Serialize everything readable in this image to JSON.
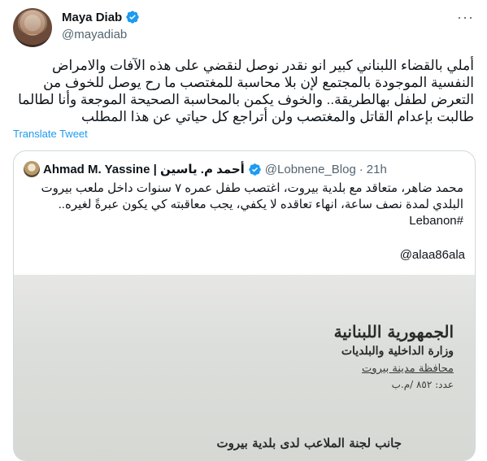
{
  "author": {
    "name": "Maya Diab",
    "handle": "@mayadiab"
  },
  "tweet": {
    "text": "أملي بالقضاء اللبناني كبير انو نقدر نوصل لنقضي على هذه الآفات والامراض النفسية الموجودة بالمجتمع لإن بلا محاسبة للمغتصب ما رح يوصل للخوف من التعرض لطفل بهالطريقة.. والخوف يكمن بالمحاسبة الصحيحة الموجعة وأنا لطالما طالبت بإعدام القاتل والمغتصب ولن أتراجع كل حياتي عن هذا المطلب",
    "translate_label": "Translate Tweet",
    "more_label": "···"
  },
  "quote": {
    "name": "Ahmad M. Yassine | أحمد م. ياسين",
    "handle": "@Lobnene_Blog",
    "separator": "·",
    "time": "21h",
    "text": "محمد ضاهر، متعاقد مع بلدية بيروت، اغتصب طفل عمره ٧ سنوات داخل ملعب بيروت البلدي لمدة نصف ساعة، انهاء تعاقده لا يكفي، يجب معاقبته كي يكون عبرةً لغيره.. #Lebanon",
    "mention": "@alaa86ala",
    "document": {
      "line1": "الجمهورية اللبنانية",
      "line2": "وزارة الداخلية والبلديات",
      "line3": "محافظة مدينة بيروت",
      "line4": "عدد: ٨٥٢ /م.ب",
      "line5": "جانب لجنة الملاعب لدى بلدية بيروت"
    }
  },
  "colors": {
    "verified": "#1d9bf0",
    "link": "#1d9bf0",
    "secondary_text": "#536471",
    "border": "#cfd9de"
  },
  "icons": {
    "verified": "verified-badge-icon",
    "more": "more-horizontal-icon"
  }
}
